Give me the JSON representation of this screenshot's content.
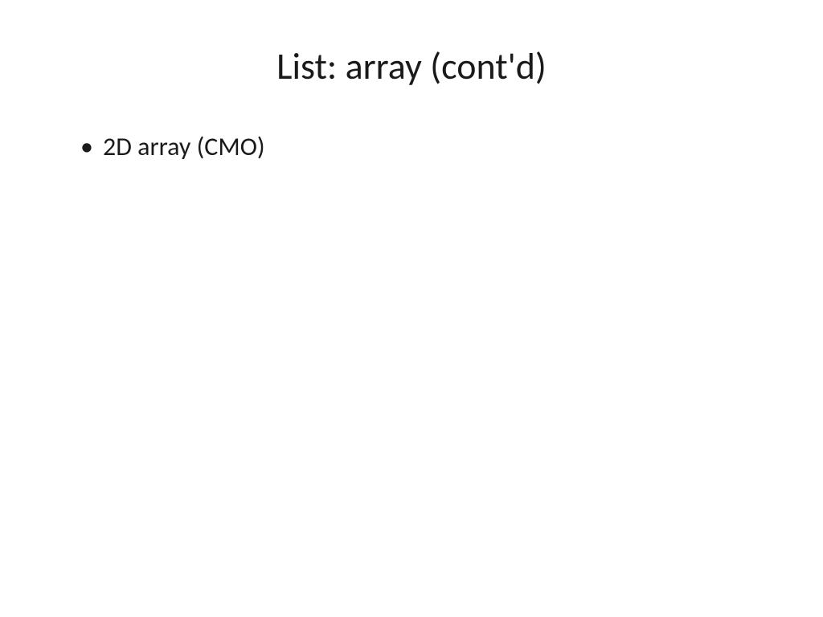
{
  "slide": {
    "title": "List: array (cont'd)",
    "bullets": [
      "2D array (CMO)"
    ]
  }
}
